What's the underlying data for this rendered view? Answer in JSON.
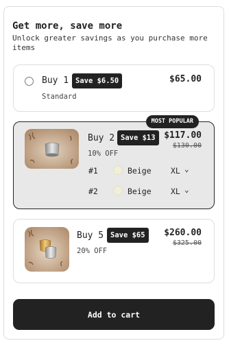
{
  "header": {
    "title": "Get more, save more",
    "subtitle": "Unlock greater savings as you purchase more items"
  },
  "bundles": [
    {
      "label": "Buy 1",
      "badge": "Save $6.50",
      "price": "$65.00",
      "note": "Standard"
    },
    {
      "label": "Buy 2",
      "badge": "Save $13",
      "price": "$117.00",
      "old_price": "$130.00",
      "note": "10% OFF",
      "tag": "MOST POPULAR",
      "variants": [
        {
          "index": "#1",
          "color": "Beige",
          "size": "XL"
        },
        {
          "index": "#2",
          "color": "Beige",
          "size": "XL"
        }
      ]
    },
    {
      "label": "Buy 5",
      "badge": "Save $65",
      "price": "$260.00",
      "old_price": "$325.00",
      "note": "20% OFF"
    }
  ],
  "swatch_color": "#f1efd8",
  "cta": {
    "label": "Add to cart"
  }
}
